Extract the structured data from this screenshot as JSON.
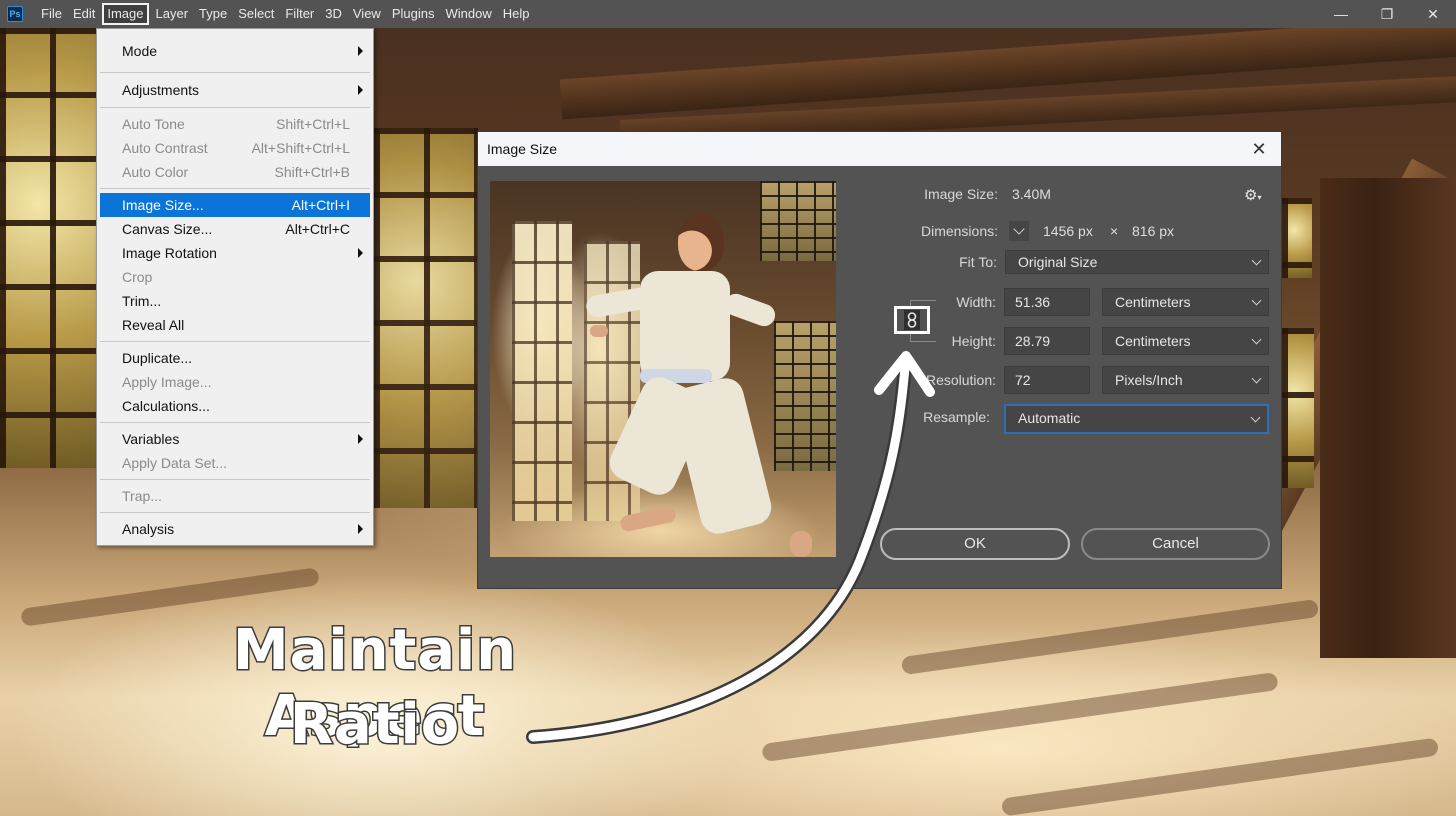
{
  "app": {
    "logo": "Ps",
    "menubar": [
      "File",
      "Edit",
      "Image",
      "Layer",
      "Type",
      "Select",
      "Filter",
      "3D",
      "View",
      "Plugins",
      "Window",
      "Help"
    ],
    "active_menu": "Image",
    "window_controls": {
      "minimize": "—",
      "restore": "❐",
      "close": "✕"
    }
  },
  "image_menu": {
    "items": [
      {
        "label": "Mode",
        "shortcut": "",
        "submenu": true,
        "disabled": false
      },
      {
        "label": "Adjustments",
        "shortcut": "",
        "submenu": true,
        "disabled": false
      },
      {
        "label": "Auto Tone",
        "shortcut": "Shift+Ctrl+L",
        "submenu": false,
        "disabled": true
      },
      {
        "label": "Auto Contrast",
        "shortcut": "Alt+Shift+Ctrl+L",
        "submenu": false,
        "disabled": true
      },
      {
        "label": "Auto Color",
        "shortcut": "Shift+Ctrl+B",
        "submenu": false,
        "disabled": true
      },
      {
        "label": "Image Size...",
        "shortcut": "Alt+Ctrl+I",
        "submenu": false,
        "disabled": false,
        "highlighted": true
      },
      {
        "label": "Canvas Size...",
        "shortcut": "Alt+Ctrl+C",
        "submenu": false,
        "disabled": false
      },
      {
        "label": "Image Rotation",
        "shortcut": "",
        "submenu": true,
        "disabled": false
      },
      {
        "label": "Crop",
        "shortcut": "",
        "submenu": false,
        "disabled": true
      },
      {
        "label": "Trim...",
        "shortcut": "",
        "submenu": false,
        "disabled": false
      },
      {
        "label": "Reveal All",
        "shortcut": "",
        "submenu": false,
        "disabled": false
      },
      {
        "label": "Duplicate...",
        "shortcut": "",
        "submenu": false,
        "disabled": false
      },
      {
        "label": "Apply Image...",
        "shortcut": "",
        "submenu": false,
        "disabled": true
      },
      {
        "label": "Calculations...",
        "shortcut": "",
        "submenu": false,
        "disabled": false
      },
      {
        "label": "Variables",
        "shortcut": "",
        "submenu": true,
        "disabled": false
      },
      {
        "label": "Apply Data Set...",
        "shortcut": "",
        "submenu": false,
        "disabled": true
      },
      {
        "label": "Trap...",
        "shortcut": "",
        "submenu": false,
        "disabled": true
      },
      {
        "label": "Analysis",
        "shortcut": "",
        "submenu": true,
        "disabled": false
      }
    ]
  },
  "dialog": {
    "title": "Image Size",
    "close_icon": "✕",
    "image_size_label": "Image Size:",
    "image_size_value": "3.40M",
    "dimensions_label": "Dimensions:",
    "dimensions_width": "1456 px",
    "dimensions_times": "×",
    "dimensions_height": "816 px",
    "fit_to_label": "Fit To:",
    "fit_to_value": "Original Size",
    "width_label": "Width:",
    "width_value": "51.36",
    "width_unit": "Centimeters",
    "height_label": "Height:",
    "height_value": "28.79",
    "height_unit": "Centimeters",
    "resolution_label": "Resolution:",
    "resolution_value": "72",
    "resolution_unit": "Pixels/Inch",
    "resample_label": "Resample:",
    "resample_value": "Automatic",
    "constrain_proportions": true,
    "ok_label": "OK",
    "cancel_label": "Cancel",
    "gear_icon": "⚙",
    "link_icon": "🔗"
  },
  "annotation": {
    "line1": "Maintain Aspect",
    "line2": "Ratio"
  },
  "colors": {
    "menubar_bg": "#535353",
    "menu_highlight": "#0a74d8",
    "dialog_bg": "#535353",
    "focus_ring": "#2f6fb8"
  }
}
